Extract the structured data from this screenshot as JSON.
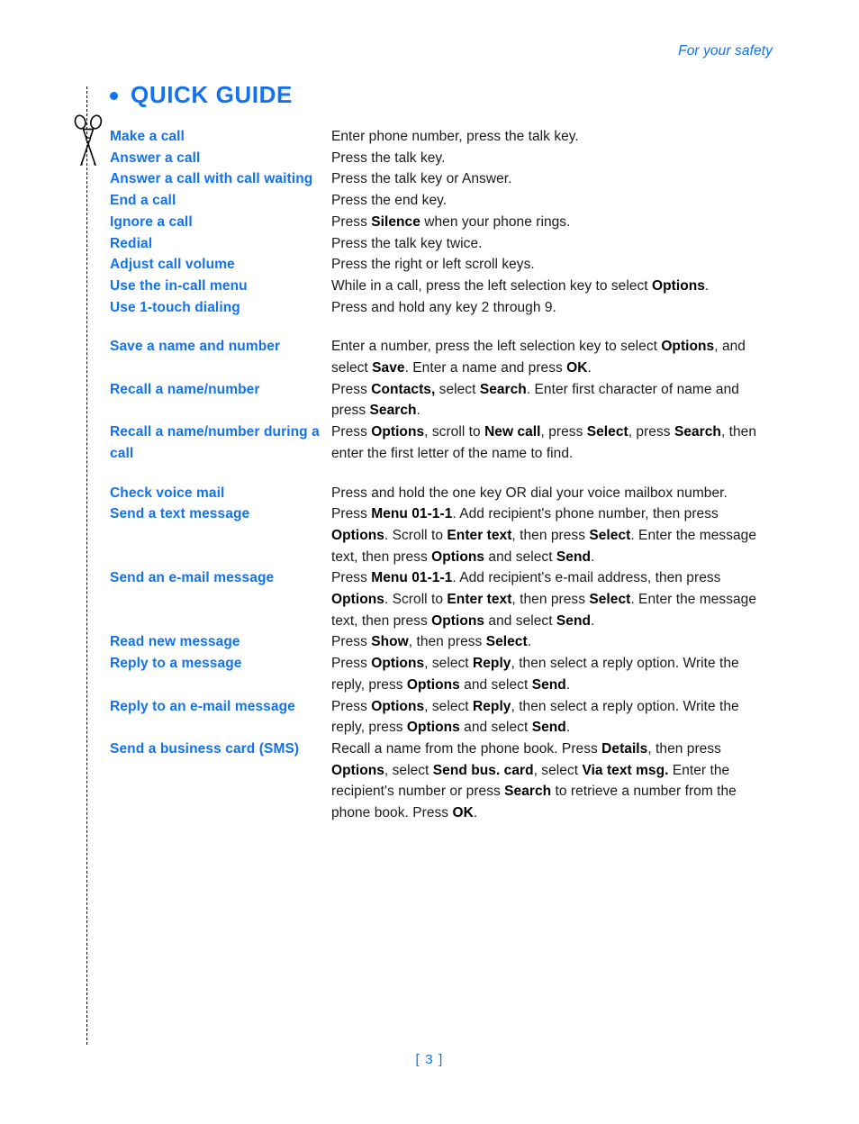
{
  "header": {
    "running_head": "For your safety"
  },
  "section": {
    "bullet": "bullet-dot",
    "title": "QUICK GUIDE"
  },
  "cut_line": {
    "icon": "scissors-icon"
  },
  "footer": {
    "page_number": "[ 3 ]"
  },
  "guide": {
    "rows": [
      {
        "term": "Make a call",
        "desc_html": "Enter phone number, press the talk key.",
        "gap_before": false
      },
      {
        "term": "Answer a call",
        "desc_html": "Press the talk key.",
        "gap_before": false
      },
      {
        "term": "Answer a call with call waiting",
        "desc_html": "Press the talk key or Answer.",
        "gap_before": false
      },
      {
        "term": "End a call",
        "desc_html": "Press the end key.",
        "gap_before": false
      },
      {
        "term": "Ignore a call",
        "desc_html": "Press <b>Silence</b> when your phone rings.",
        "gap_before": false
      },
      {
        "term": "Redial",
        "desc_html": "Press the talk key twice.",
        "gap_before": false
      },
      {
        "term": "Adjust call volume",
        "desc_html": "Press the right or left scroll keys.",
        "gap_before": false
      },
      {
        "term": "Use the in-call menu",
        "desc_html": "While in a call, press the left selection key to select <b>Options</b>.",
        "gap_before": false
      },
      {
        "term": "Use 1-touch dialing",
        "desc_html": "Press and hold any key 2 through 9.",
        "gap_before": false
      },
      {
        "term": "Save a name and number",
        "desc_html": "Enter a number, press the left selection key to select <b>Options</b>, and select <b>Save</b>. Enter a name and press <b>OK</b>.",
        "gap_before": true
      },
      {
        "term": "Recall a name/number",
        "desc_html": "Press <b>Contacts,</b> select <b>Search</b>. Enter first character of name and press <b>Search</b>.",
        "gap_before": false
      },
      {
        "term": "Recall a name/number during a call",
        "desc_html": "Press <b>Options</b>, scroll to <b>New call</b>, press <b>Select</b>, press <b>Search</b>, then enter the first letter of the name to find.",
        "gap_before": false
      },
      {
        "term": "Check voice mail",
        "desc_html": "Press and hold the one key OR dial your voice mailbox number.",
        "gap_before": true
      },
      {
        "term": "Send a text message",
        "desc_html": "Press <b>Menu 01-1-1</b>. Add recipient's phone number, then press <b>Options</b>. Scroll to <b>Enter text</b>, then press <b>Select</b>. Enter the message text, then press <b>Options</b> and select <b>Send</b>.",
        "gap_before": false
      },
      {
        "term": "Send an e-mail message",
        "desc_html": "Press <b>Menu 01-1-1</b>. Add recipient's e-mail address, then press <b>Options</b>. Scroll to <b>Enter text</b>, then press <b>Select</b>. Enter the message text, then press <b>Options</b> and select <b>Send</b>.",
        "gap_before": false
      },
      {
        "term": "Read new message",
        "desc_html": "Press <b>Show</b>, then press <b>Select</b>.",
        "gap_before": false
      },
      {
        "term": "Reply to a message",
        "desc_html": "Press <b>Options</b>, select <b>Reply</b>, then select a reply option. Write the reply, press <b>Options</b> and select <b>Send</b>.",
        "gap_before": false
      },
      {
        "term": "Reply to an e-mail message",
        "desc_html": "Press <b>Options</b>, select <b>Reply</b>, then select a reply option. Write the reply, press <b>Options</b> and select <b>Send</b>.",
        "gap_before": false
      },
      {
        "term": "Send a business card (SMS)",
        "desc_html": "Recall a name from the phone book. Press <b>Details</b>, then press <b>Options</b>, select <b>Send bus. card</b>, select <b>Via text msg.</b> Enter the recipient's number or press <b>Search</b> to retrieve a number from the phone book. Press <b>OK</b>.",
        "gap_before": false
      }
    ]
  },
  "colors": {
    "accent_blue": "#1272ef",
    "body_text": "#1a1a1a"
  }
}
